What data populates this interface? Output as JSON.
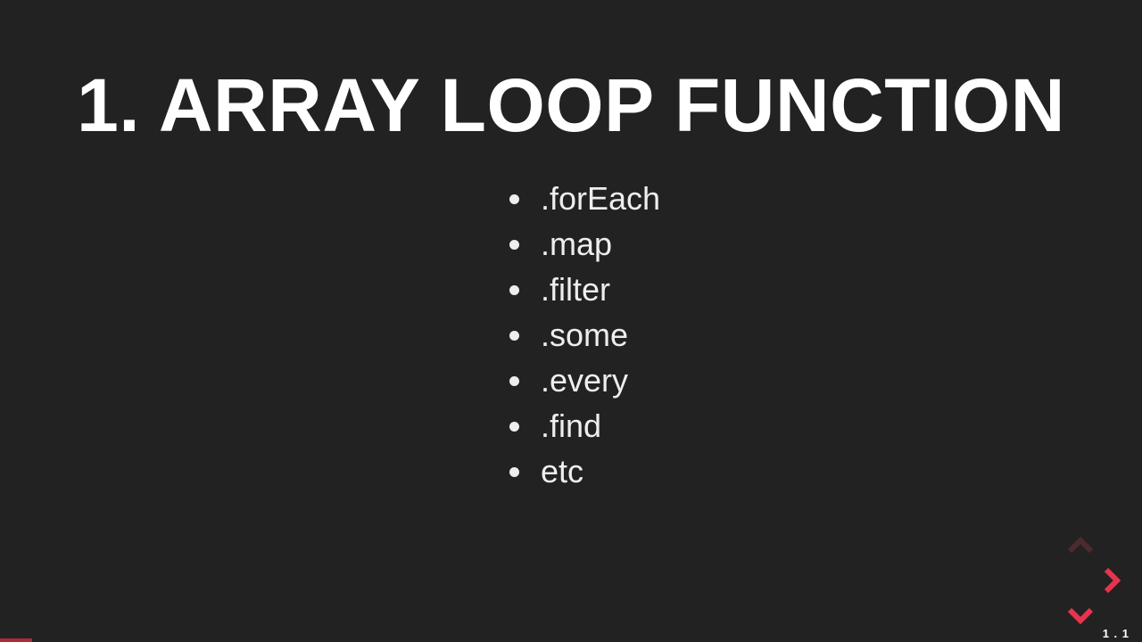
{
  "slide": {
    "title": "1. ARRAY LOOP FUNCTION",
    "items": [
      ".forEach",
      ".map",
      ".filter",
      ".some",
      ".every",
      ".find",
      "etc"
    ],
    "slideNumber": "1 . 1"
  },
  "nav": {
    "up": {
      "enabled": false
    },
    "right": {
      "enabled": true
    },
    "down": {
      "enabled": true
    },
    "left": {
      "enabled": false
    }
  },
  "progress": {
    "widthPx": 36
  },
  "colors": {
    "bg": "#222222",
    "accent": "#e7344c",
    "accentDim": "#4d2a2d",
    "progress": "#b2283a"
  }
}
